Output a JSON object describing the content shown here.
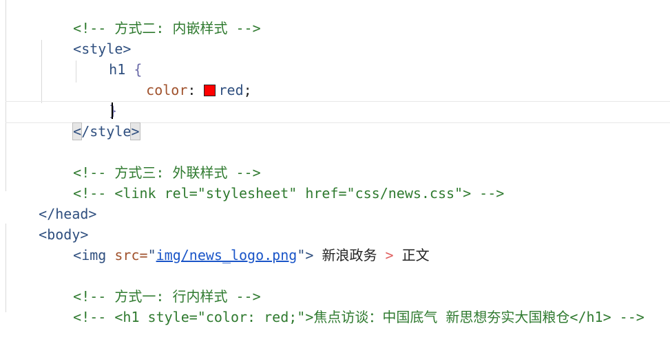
{
  "lines": {
    "l1": "<!-- 方式二: 内嵌样式 -->",
    "l2_tag": "<style>",
    "l3_sel": "h1",
    "l3_brace": "{",
    "l4_prop": "color",
    "l4_colon": ":",
    "l4_val": "red",
    "l4_semi": ";",
    "l5_brace": "}",
    "l6_open": "<",
    "l6_mid": "/style",
    "l6_close": ">",
    "l8": "<!-- 方式三: 外联样式 -->",
    "l9": "<!-- <link rel=\"stylesheet\" href=\"css/news.css\"> -->",
    "l10": "</head>",
    "l11": "<body>",
    "l12_open": "<img ",
    "l12_attr": "src=",
    "l12_q1": "\"",
    "l12_link": "img/news_logo.png",
    "l12_q2": "\"",
    "l12_close": ">",
    "l12_text1": "新浪政务",
    "l12_gt": ">",
    "l12_text2": "正文",
    "l14": "<!-- 方式一: 行内样式 -->",
    "l15": "<!-- <h1 style=\"color: red;\">焦点访谈：中国底气 新思想夯实大国粮仓</h1> -->"
  },
  "colors": {
    "swatch": "#ff0000",
    "comment": "#2f7a2f",
    "tag": "#2f4f7f",
    "link": "#1a55c8"
  }
}
